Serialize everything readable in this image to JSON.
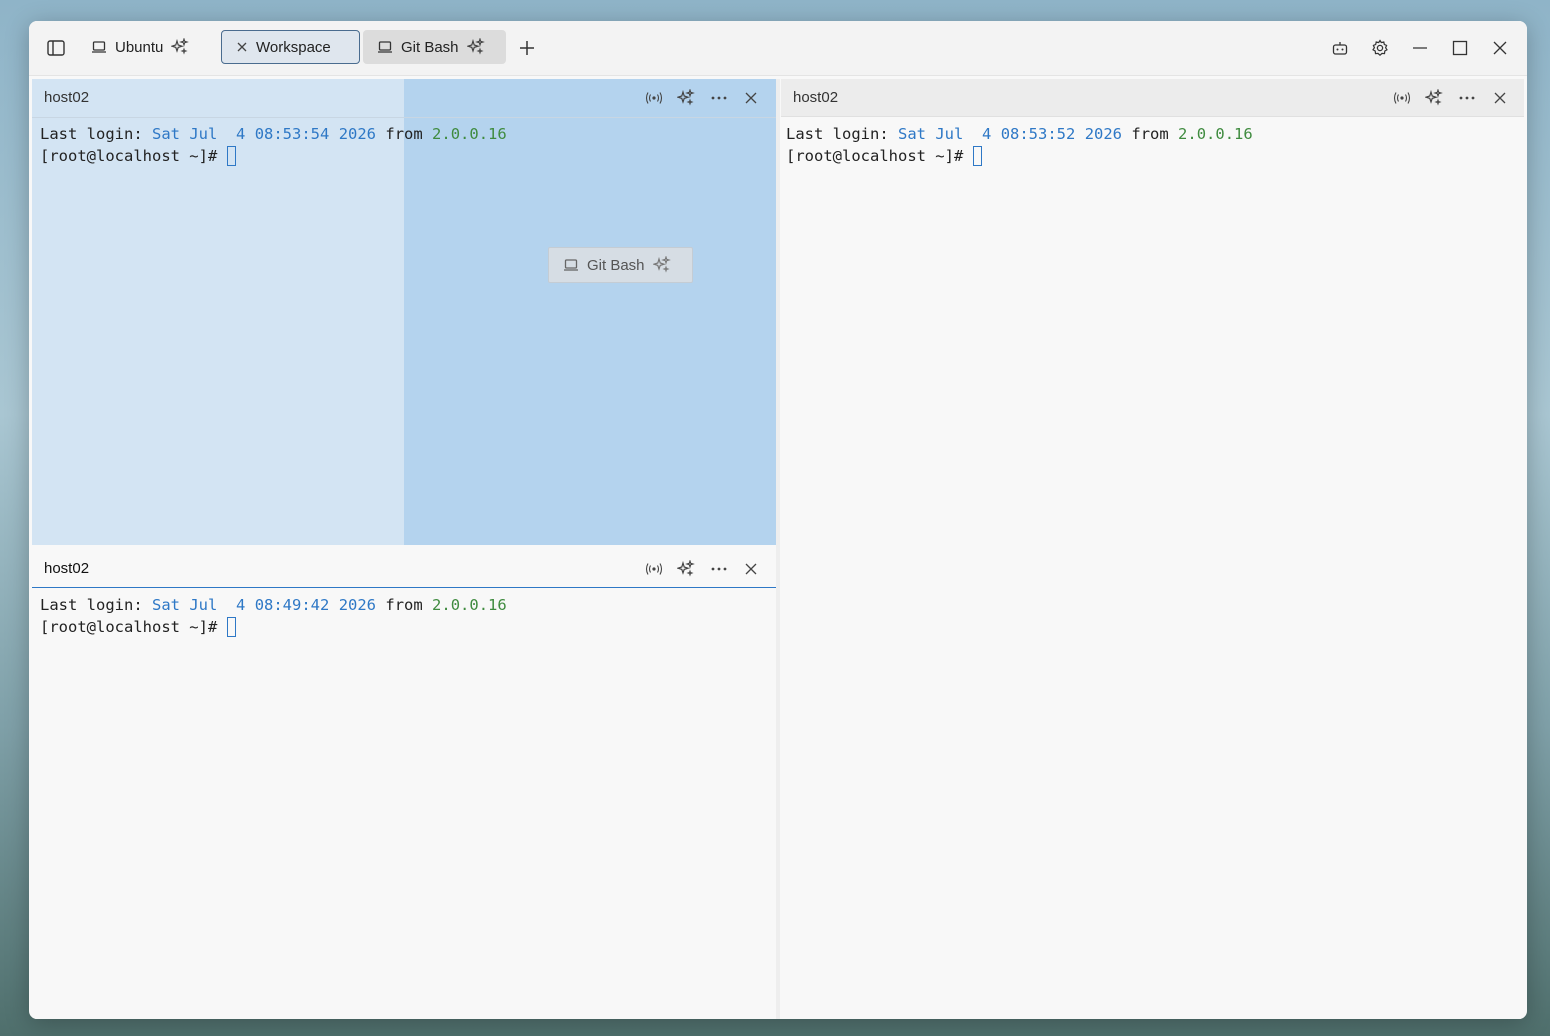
{
  "window": {
    "tabs": [
      {
        "label": "Ubuntu",
        "icon": "laptop-icon",
        "active": false
      },
      {
        "label": "Workspace",
        "icon": "close-icon",
        "active": true
      },
      {
        "label": "Git Bash",
        "icon": "laptop-icon",
        "active": false
      }
    ],
    "controls": [
      "robot-icon",
      "gear-icon",
      "minimize-icon",
      "maximize-icon",
      "close-icon"
    ]
  },
  "panes": [
    {
      "title": "host02",
      "lines": {
        "label": "Last login: ",
        "day": "Sat",
        "month": "Jul",
        "date": "4",
        "time": "08:53:54",
        "year": "2026",
        "from": "from",
        "ip": "2.0.0.16",
        "prompt": "[root@localhost ~]#"
      }
    },
    {
      "title": "host02",
      "lines": {
        "label": "Last login: ",
        "day": "Sat",
        "month": "Jul",
        "date": "4",
        "time": "08:49:42",
        "year": "2026",
        "from": "from",
        "ip": "2.0.0.16",
        "prompt": "[root@localhost ~]#"
      }
    },
    {
      "title": "host02",
      "lines": {
        "label": "Last login: ",
        "day": "Sat",
        "month": "Jul",
        "date": "4",
        "time": "08:53:52",
        "year": "2026",
        "from": "from",
        "ip": "2.0.0.16",
        "prompt": "[root@localhost ~]#"
      }
    }
  ],
  "drag_ghost": {
    "label": "Git Bash"
  },
  "colors": {
    "accent": "#2e78c6",
    "drop_zone": "#b4d3ee",
    "drop_zone_light": "#d3e4f3"
  }
}
